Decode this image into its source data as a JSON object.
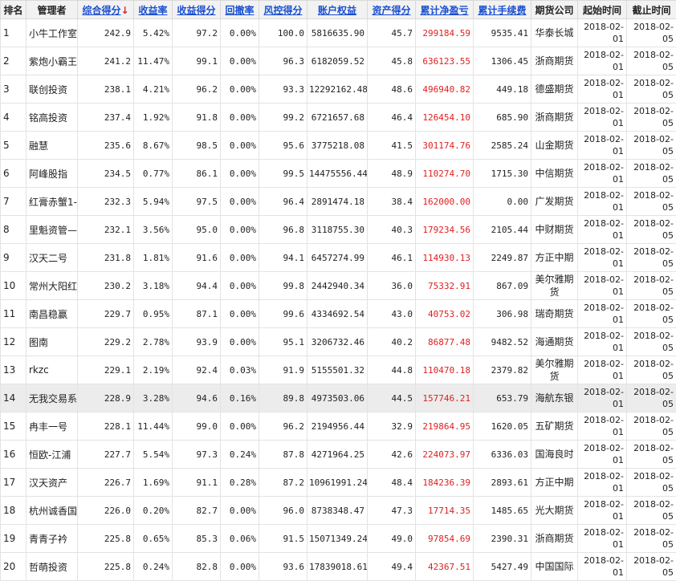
{
  "headers": [
    {
      "label": "排名",
      "sortable": false
    },
    {
      "label": "管理者",
      "sortable": false
    },
    {
      "label": "综合得分",
      "sortable": true,
      "sorted": true,
      "sort_icon": "arrow-down-icon",
      "sort_glyph": "↓"
    },
    {
      "label": "收益率",
      "sortable": true
    },
    {
      "label": "收益得分",
      "sortable": true
    },
    {
      "label": "回撤率",
      "sortable": true
    },
    {
      "label": "风控得分",
      "sortable": true
    },
    {
      "label": "账户权益",
      "sortable": true
    },
    {
      "label": "资产得分",
      "sortable": true
    },
    {
      "label": "累计净盈亏",
      "sortable": true
    },
    {
      "label": "累计手续费",
      "sortable": true
    },
    {
      "label": "期货公司",
      "sortable": false
    },
    {
      "label": "起始时间",
      "sortable": false
    },
    {
      "label": "截止时间",
      "sortable": false
    }
  ],
  "colors": {
    "link": "#1a4fd0",
    "profit": "#e01e1e",
    "sort_arrow": "#e01e1e",
    "header_bg": "#f2f2f2",
    "highlight_row_bg": "#ececec"
  },
  "highlighted_row_index": 13,
  "rows": [
    {
      "rank": "1",
      "manager": "小牛工作室",
      "score": "242.9",
      "return_rate": "5.42%",
      "return_score": "97.2",
      "drawdown": "0.00%",
      "risk_score": "100.0",
      "equity": "5816635.90",
      "asset_score": "45.7",
      "net_pnl": "299184.59",
      "fees": "9535.41",
      "firm": "华泰长城",
      "start_date": [
        "2018-02-",
        "01"
      ],
      "end_date": [
        "2018-02-",
        "05"
      ]
    },
    {
      "rank": "2",
      "manager": "紫炮小霸王",
      "score": "241.2",
      "return_rate": "11.47%",
      "return_score": "99.1",
      "drawdown": "0.00%",
      "risk_score": "96.3",
      "equity": "6182059.52",
      "asset_score": "45.8",
      "net_pnl": "636123.55",
      "fees": "1306.45",
      "firm": "浙商期货",
      "start_date": [
        "2018-02-",
        "01"
      ],
      "end_date": [
        "2018-02-",
        "05"
      ]
    },
    {
      "rank": "3",
      "manager": "联创投资",
      "score": "238.1",
      "return_rate": "4.21%",
      "return_score": "96.2",
      "drawdown": "0.00%",
      "risk_score": "93.3",
      "equity": "12292162.48",
      "asset_score": "48.6",
      "net_pnl": "496940.82",
      "fees": "449.18",
      "firm": "德盛期货",
      "start_date": [
        "2018-02-",
        "01"
      ],
      "end_date": [
        "2018-02-",
        "05"
      ]
    },
    {
      "rank": "4",
      "manager": "铭高投资",
      "score": "237.4",
      "return_rate": "1.92%",
      "return_score": "91.8",
      "drawdown": "0.00%",
      "risk_score": "99.2",
      "equity": "6721657.68",
      "asset_score": "46.4",
      "net_pnl": "126454.10",
      "fees": "685.90",
      "firm": "浙商期货",
      "start_date": [
        "2018-02-",
        "01"
      ],
      "end_date": [
        "2018-02-",
        "05"
      ]
    },
    {
      "rank": "5",
      "manager": "融慧",
      "score": "235.6",
      "return_rate": "8.67%",
      "return_score": "98.5",
      "drawdown": "0.00%",
      "risk_score": "95.6",
      "equity": "3775218.08",
      "asset_score": "41.5",
      "net_pnl": "301174.76",
      "fees": "2585.24",
      "firm": "山金期货",
      "start_date": [
        "2018-02-",
        "01"
      ],
      "end_date": [
        "2018-02-",
        "05"
      ]
    },
    {
      "rank": "6",
      "manager": "阿峰股指",
      "score": "234.5",
      "return_rate": "0.77%",
      "return_score": "86.1",
      "drawdown": "0.00%",
      "risk_score": "99.5",
      "equity": "14475556.44",
      "asset_score": "48.9",
      "net_pnl": "110274.70",
      "fees": "1715.30",
      "firm": "中信期货",
      "start_date": [
        "2018-02-",
        "01"
      ],
      "end_date": [
        "2018-02-",
        "05"
      ]
    },
    {
      "rank": "7",
      "manager": "红膏赤蟹1-",
      "score": "232.3",
      "return_rate": "5.94%",
      "return_score": "97.5",
      "drawdown": "0.00%",
      "risk_score": "96.4",
      "equity": "2891474.18",
      "asset_score": "38.4",
      "net_pnl": "162000.00",
      "fees": "0.00",
      "firm": "广发期货",
      "start_date": [
        "2018-02-",
        "01"
      ],
      "end_date": [
        "2018-02-",
        "05"
      ]
    },
    {
      "rank": "8",
      "manager": "里魁资管—",
      "score": "232.1",
      "return_rate": "3.56%",
      "return_score": "95.0",
      "drawdown": "0.00%",
      "risk_score": "96.8",
      "equity": "3118755.30",
      "asset_score": "40.3",
      "net_pnl": "179234.56",
      "fees": "2105.44",
      "firm": "中财期货",
      "start_date": [
        "2018-02-",
        "01"
      ],
      "end_date": [
        "2018-02-",
        "05"
      ]
    },
    {
      "rank": "9",
      "manager": "汉天二号",
      "score": "231.8",
      "return_rate": "1.81%",
      "return_score": "91.6",
      "drawdown": "0.00%",
      "risk_score": "94.1",
      "equity": "6457274.99",
      "asset_score": "46.1",
      "net_pnl": "114930.13",
      "fees": "2249.87",
      "firm": "方正中期",
      "start_date": [
        "2018-02-",
        "01"
      ],
      "end_date": [
        "2018-02-",
        "05"
      ]
    },
    {
      "rank": "10",
      "manager": "常州大阳红",
      "score": "230.2",
      "return_rate": "3.18%",
      "return_score": "94.4",
      "drawdown": "0.00%",
      "risk_score": "99.8",
      "equity": "2442940.34",
      "asset_score": "36.0",
      "net_pnl": "75332.91",
      "fees": "867.09",
      "firm": "美尔雅期货",
      "start_date": [
        "2018-02-",
        "01"
      ],
      "end_date": [
        "2018-02-",
        "05"
      ]
    },
    {
      "rank": "11",
      "manager": "南昌稳赢",
      "score": "229.7",
      "return_rate": "0.95%",
      "return_score": "87.1",
      "drawdown": "0.00%",
      "risk_score": "99.6",
      "equity": "4334692.54",
      "asset_score": "43.0",
      "net_pnl": "40753.02",
      "fees": "306.98",
      "firm": "瑞奇期货",
      "start_date": [
        "2018-02-",
        "01"
      ],
      "end_date": [
        "2018-02-",
        "05"
      ]
    },
    {
      "rank": "12",
      "manager": "图南",
      "score": "229.2",
      "return_rate": "2.78%",
      "return_score": "93.9",
      "drawdown": "0.00%",
      "risk_score": "95.1",
      "equity": "3206732.46",
      "asset_score": "40.2",
      "net_pnl": "86877.48",
      "fees": "9482.52",
      "firm": "海通期货",
      "start_date": [
        "2018-02-",
        "01"
      ],
      "end_date": [
        "2018-02-",
        "05"
      ]
    },
    {
      "rank": "13",
      "manager": "rkzc",
      "score": "229.1",
      "return_rate": "2.19%",
      "return_score": "92.4",
      "drawdown": "0.03%",
      "risk_score": "91.9",
      "equity": "5155501.32",
      "asset_score": "44.8",
      "net_pnl": "110470.18",
      "fees": "2379.82",
      "firm": "美尔雅期货",
      "start_date": [
        "2018-02-",
        "01"
      ],
      "end_date": [
        "2018-02-",
        "05"
      ]
    },
    {
      "rank": "14",
      "manager": "无我交易系",
      "score": "228.9",
      "return_rate": "3.28%",
      "return_score": "94.6",
      "drawdown": "0.16%",
      "risk_score": "89.8",
      "equity": "4973503.06",
      "asset_score": "44.5",
      "net_pnl": "157746.21",
      "fees": "653.79",
      "firm": "海航东银",
      "start_date": [
        "2018-02-",
        "01"
      ],
      "end_date": [
        "2018-02-",
        "05"
      ]
    },
    {
      "rank": "15",
      "manager": "冉丰一号",
      "score": "228.1",
      "return_rate": "11.44%",
      "return_score": "99.0",
      "drawdown": "0.00%",
      "risk_score": "96.2",
      "equity": "2194956.44",
      "asset_score": "32.9",
      "net_pnl": "219864.95",
      "fees": "1620.05",
      "firm": "五矿期货",
      "start_date": [
        "2018-02-",
        "01"
      ],
      "end_date": [
        "2018-02-",
        "05"
      ]
    },
    {
      "rank": "16",
      "manager": "恒欧-江浦",
      "score": "227.7",
      "return_rate": "5.54%",
      "return_score": "97.3",
      "drawdown": "0.24%",
      "risk_score": "87.8",
      "equity": "4271964.25",
      "asset_score": "42.6",
      "net_pnl": "224073.97",
      "fees": "6336.03",
      "firm": "国海良时",
      "start_date": [
        "2018-02-",
        "01"
      ],
      "end_date": [
        "2018-02-",
        "05"
      ]
    },
    {
      "rank": "17",
      "manager": "汉天资产",
      "score": "226.7",
      "return_rate": "1.69%",
      "return_score": "91.1",
      "drawdown": "0.28%",
      "risk_score": "87.2",
      "equity": "10961991.24",
      "asset_score": "48.4",
      "net_pnl": "184236.39",
      "fees": "2893.61",
      "firm": "方正中期",
      "start_date": [
        "2018-02-",
        "01"
      ],
      "end_date": [
        "2018-02-",
        "05"
      ]
    },
    {
      "rank": "18",
      "manager": "杭州诚香国",
      "score": "226.0",
      "return_rate": "0.20%",
      "return_score": "82.7",
      "drawdown": "0.00%",
      "risk_score": "96.0",
      "equity": "8738348.47",
      "asset_score": "47.3",
      "net_pnl": "17714.35",
      "fees": "1485.65",
      "firm": "光大期货",
      "start_date": [
        "2018-02-",
        "01"
      ],
      "end_date": [
        "2018-02-",
        "05"
      ]
    },
    {
      "rank": "19",
      "manager": "青青子衿",
      "score": "225.8",
      "return_rate": "0.65%",
      "return_score": "85.3",
      "drawdown": "0.06%",
      "risk_score": "91.5",
      "equity": "15071349.24",
      "asset_score": "49.0",
      "net_pnl": "97854.69",
      "fees": "2390.31",
      "firm": "浙商期货",
      "start_date": [
        "2018-02-",
        "01"
      ],
      "end_date": [
        "2018-02-",
        "05"
      ]
    },
    {
      "rank": "20",
      "manager": "哲萌投资",
      "score": "225.8",
      "return_rate": "0.24%",
      "return_score": "82.8",
      "drawdown": "0.00%",
      "risk_score": "93.6",
      "equity": "17839018.61",
      "asset_score": "49.4",
      "net_pnl": "42367.51",
      "fees": "5427.49",
      "firm": "中国国际",
      "start_date": [
        "2018-02-",
        "01"
      ],
      "end_date": [
        "2018-02-",
        "05"
      ]
    }
  ]
}
